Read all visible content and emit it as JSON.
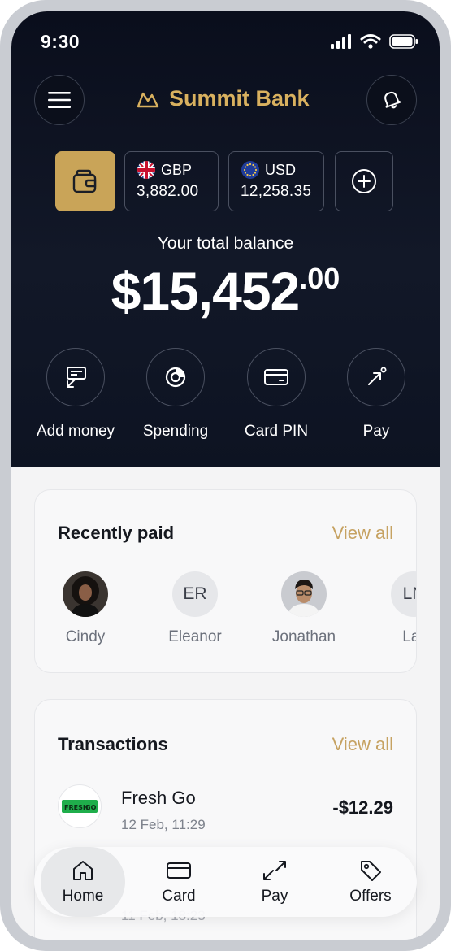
{
  "status_bar": {
    "time": "9:30"
  },
  "header": {
    "brand_name": "Summit Bank"
  },
  "currencies": [
    {
      "code": "GBP",
      "amount": "3,882.00"
    },
    {
      "code": "USD",
      "amount": "12,258.35"
    }
  ],
  "balance": {
    "label": "Your total balance",
    "main": "$15,452",
    "cents": ".00"
  },
  "actions": [
    {
      "label": "Add money",
      "icon": "add-money-icon"
    },
    {
      "label": "Spending",
      "icon": "spending-chart-icon"
    },
    {
      "label": "Card PIN",
      "icon": "card-icon"
    },
    {
      "label": "Pay",
      "icon": "pay-arrow-icon"
    }
  ],
  "recently_paid": {
    "title": "Recently paid",
    "view_all": "View all",
    "people": [
      {
        "name": "Cindy",
        "initials": ""
      },
      {
        "name": "Eleanor",
        "initials": "ER"
      },
      {
        "name": "Jonathan",
        "initials": ""
      },
      {
        "name": "Lar",
        "initials": "LN"
      }
    ]
  },
  "transactions": {
    "title": "Transactions",
    "view_all": "View all",
    "items": [
      {
        "name": "Fresh Go",
        "date": "12 Feb, 11:29",
        "amount": "-$12.29",
        "logo_text_1": "FRESH",
        "logo_text_2": "GO"
      },
      {
        "date": "11 Feb, 18:23"
      }
    ]
  },
  "tabbar": {
    "tabs": [
      {
        "label": "Home",
        "icon": "home-icon",
        "active": true
      },
      {
        "label": "Card",
        "icon": "card-icon",
        "active": false
      },
      {
        "label": "Pay",
        "icon": "transfer-arrows-icon",
        "active": false
      },
      {
        "label": "Offers",
        "icon": "tag-icon",
        "active": false
      }
    ]
  },
  "colors": {
    "hero_bg": "#0d1322",
    "gold_accent": "#c9a458",
    "brand_text": "#d9b15f",
    "page_bg": "#f4f4f5"
  }
}
